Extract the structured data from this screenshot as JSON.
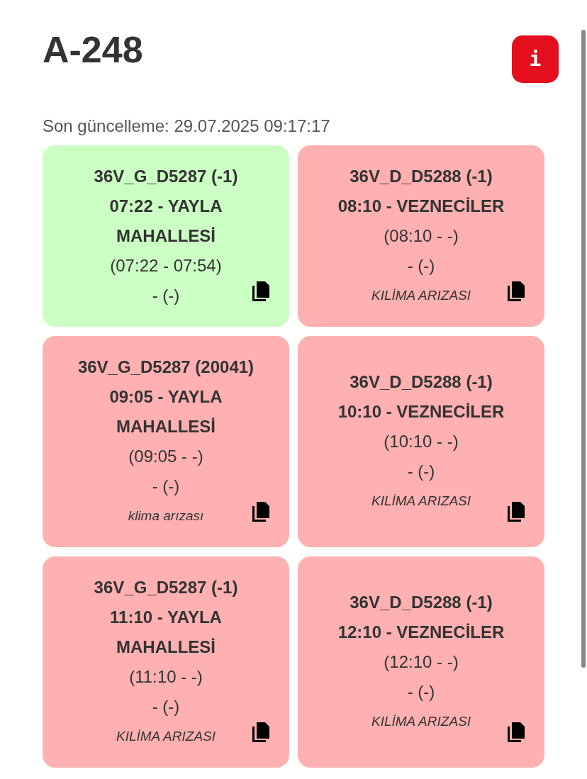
{
  "header": {
    "title": "A-248",
    "info_button": "i"
  },
  "last_update": "Son güncelleme: 29.07.2025 09:17:17",
  "cards": [
    {
      "title": "36V_G_D5287 (-1)",
      "route": "07:22 - YAYLA MAHALLESİ",
      "times": "(07:22 - 07:54)",
      "detail": "- (-)",
      "color": "#ccffc4"
    },
    {
      "title": "36V_D_D5288 (-1)",
      "route": "08:10 - VEZNECİLER",
      "times": "(08:10 - -)",
      "detail": "- (-)",
      "remark": "KILİMA ARIZASI",
      "color": "#ffb0b0"
    },
    {
      "title": "36V_G_D5287 (20041)",
      "route": "09:05 - YAYLA MAHALLESİ",
      "times": "(09:05 - -)",
      "detail": "- (-)",
      "remark": "klima arızası",
      "color": "#ffb0b0"
    },
    {
      "title": "36V_D_D5288 (-1)",
      "route": "10:10 - VEZNECİLER",
      "times": "(10:10 - -)",
      "detail": "- (-)",
      "remark": "KILİMA ARIZASI",
      "color": "#ffb0b0"
    },
    {
      "title": "36V_G_D5287 (-1)",
      "route": "11:10 - YAYLA MAHALLESİ",
      "times": "(11:10 - -)",
      "detail": "- (-)",
      "remark": "KILİMA ARIZASI",
      "color": "#ffb0b0"
    },
    {
      "title": "36V_D_D5288 (-1)",
      "route": "12:10 - VEZNECİLER",
      "times": "(12:10 - -)",
      "detail": "- (-)",
      "remark": "KILİMA ARIZASI",
      "color": "#ffb0b0"
    }
  ]
}
